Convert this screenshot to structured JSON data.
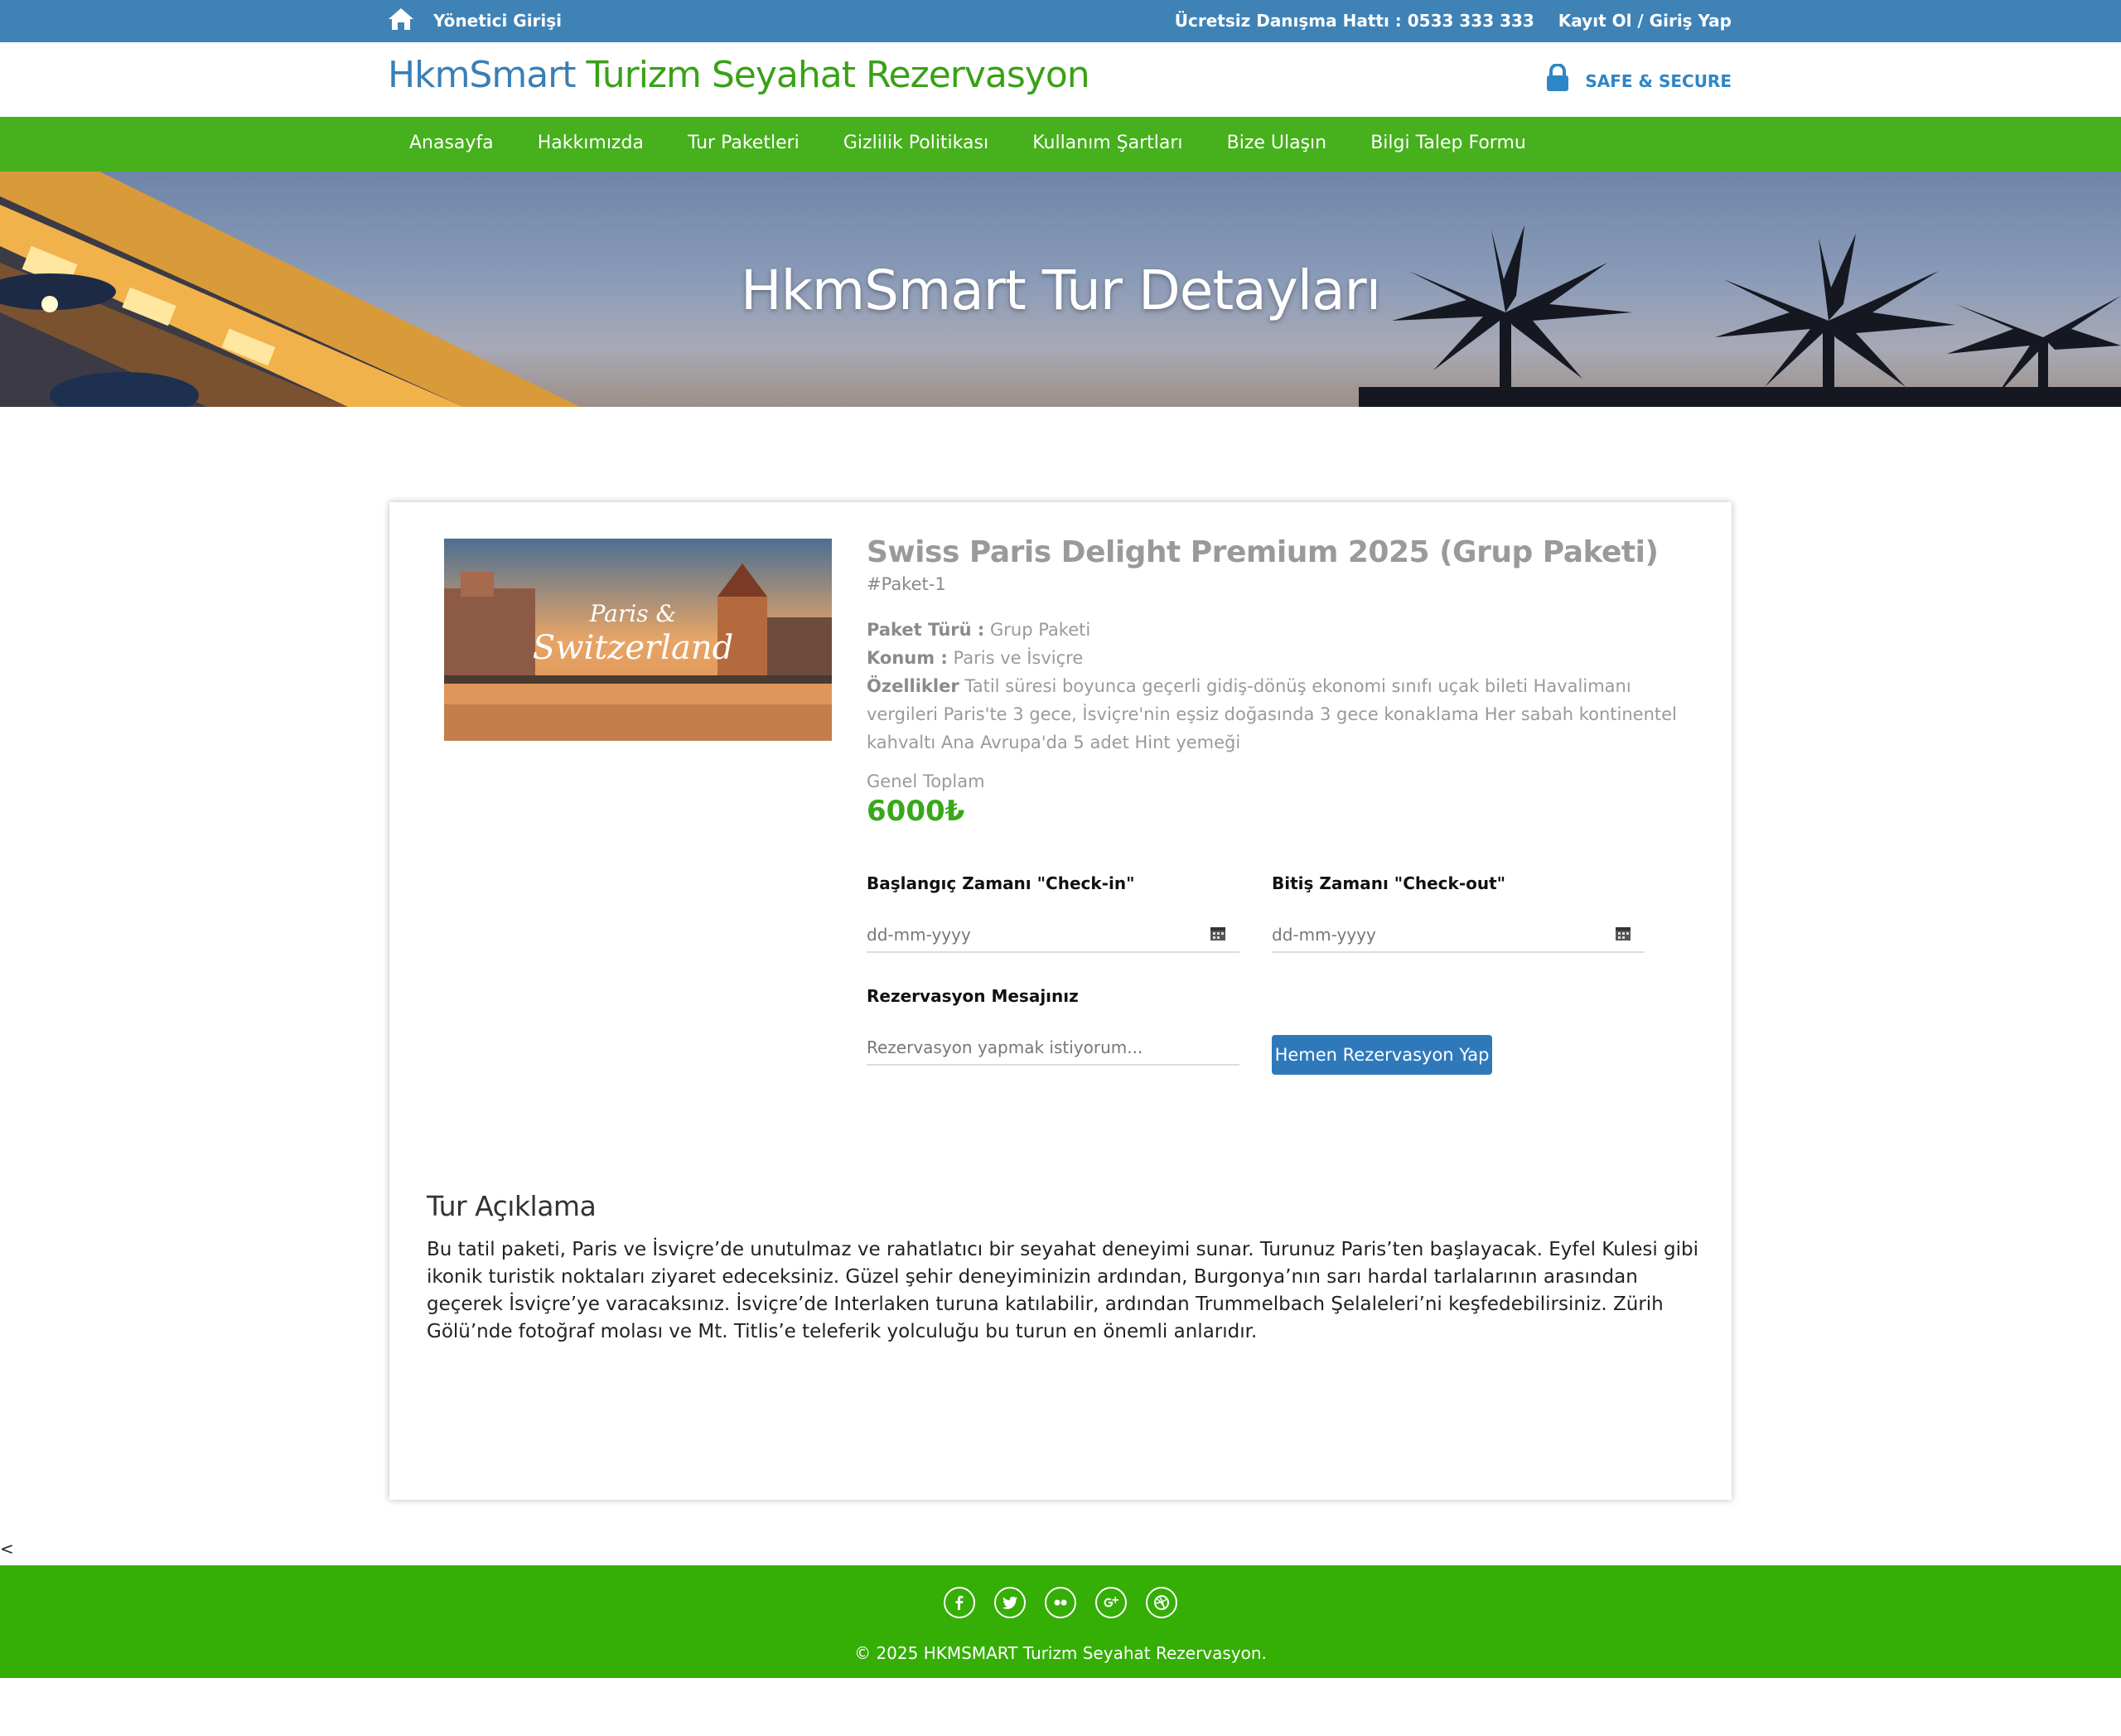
{
  "topbar": {
    "admin_label": "Yönetici Girişi",
    "hotline": "Ücretsiz Danışma Hattı : 0533 333 333",
    "login_label": "Kayıt Ol / Giriş Yap"
  },
  "header": {
    "brand_part1": "HkmSmart",
    "brand_part2": "Turizm Seyahat Rezervasyon",
    "secure_label": "SAFE & SECURE"
  },
  "nav": {
    "items": [
      "Anasayfa",
      "Hakkımızda",
      "Tur Paketleri",
      "Gizlilik Politikası",
      "Kullanım Şartları",
      "Bize Ulaşın",
      "Bilgi Talep Formu"
    ]
  },
  "hero": {
    "title": "HkmSmart Tur Detayları"
  },
  "package": {
    "thumb_line1": "Paris &",
    "thumb_line2": "Switzerland",
    "title": "Swiss Paris Delight Premium 2025 (Grup Paketi)",
    "code": "#Paket-1",
    "type_label": "Paket Türü :",
    "type_value": "Grup Paketi",
    "location_label": "Konum :",
    "location_value": "Paris ve İsviçre",
    "features_label": "Özellikler",
    "features_value": "Tatil süresi boyunca geçerli gidiş-dönüş ekonomi sınıfı uçak bileti Havalimanı vergileri Paris'te 3 gece, İsviçre'nin eşsiz doğasında 3 gece konaklama Her sabah kontinentel kahvaltı Ana Avrupa'da 5 adet Hint yemeği",
    "total_label": "Genel Toplam",
    "total_value": "6000₺"
  },
  "form": {
    "checkin_label": "Başlangıç Zamanı \"Check-in\"",
    "checkin_placeholder": "dd-mm-yyyy",
    "checkout_label": "Bitiş Zamanı \"Check-out\"",
    "checkout_placeholder": "dd-mm-yyyy",
    "message_label": "Rezervasyon Mesajınız",
    "message_placeholder": "Rezervasyon yapmak istiyorum...",
    "submit_label": "Hemen Rezervasyon Yap"
  },
  "description": {
    "title": "Tur Açıklama",
    "text": "Bu tatil paketi, Paris ve İsviçre’de unutulmaz ve rahatlatıcı bir seyahat deneyimi sunar. Turunuz Paris’ten başlayacak. Eyfel Kulesi gibi ikonik turistik noktaları ziyaret edeceksiniz. Güzel şehir deneyiminizin ardından, Burgonya’nın sarı hardal tarlalarının arasından geçerek İsviçre’ye varacaksınız. İsviçre’de Interlaken turuna katılabilir, ardından Trummelbach Şelaleleri’ni keşfedebilirsiniz. Zürih Gölü’nde fotoğraf molası ve Mt. Titlis’e teleferik yolculuğu bu turun en önemli anlarıdır."
  },
  "stray_char": "<",
  "footer": {
    "socials": [
      "facebook-icon",
      "twitter-icon",
      "flickr-icon",
      "google-plus-icon",
      "dribbble-icon"
    ],
    "copyright": "© 2025 HKMSMART Turizm Seyahat Rezervasyon."
  },
  "colors": {
    "topbar": "#3f83b6",
    "nav": "#46b01d",
    "footer": "#35ae06",
    "brand_blue": "#3a7fb5",
    "brand_green": "#3aa116",
    "price_green": "#37a81a",
    "button": "#2f79bb"
  }
}
